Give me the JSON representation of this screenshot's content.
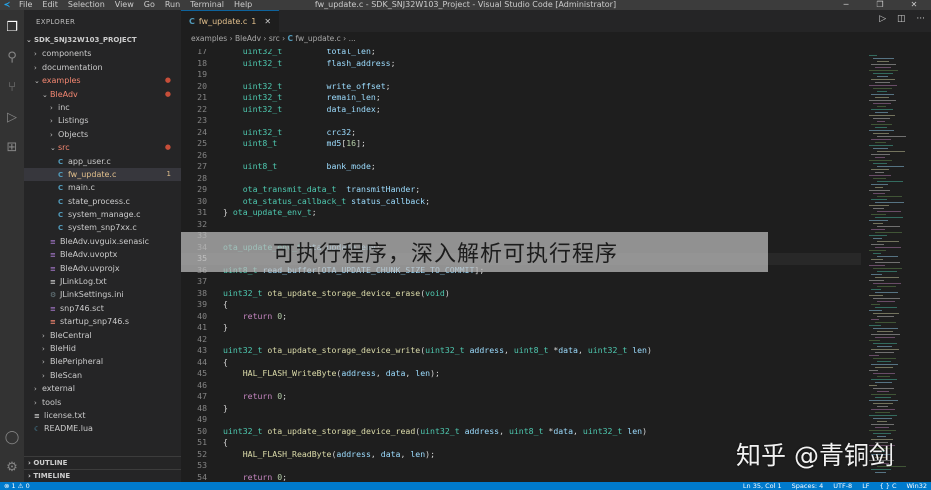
{
  "titlebar": {
    "menu": [
      "File",
      "Edit",
      "Selection",
      "View",
      "Go",
      "Run",
      "Terminal",
      "Help"
    ],
    "title": "fw_update.c - SDK_SNJ32W103_Project - Visual Studio Code [Administrator]"
  },
  "sidebar": {
    "header": "EXPLORER",
    "project": "SDK_SNJ32W103_PROJECT",
    "items": [
      {
        "label": "components",
        "indent": 1,
        "type": "folder",
        "open": false
      },
      {
        "label": "documentation",
        "indent": 1,
        "type": "folder",
        "open": false
      },
      {
        "label": "examples",
        "indent": 1,
        "type": "folder",
        "open": true,
        "color": "red",
        "dot": true
      },
      {
        "label": "BleAdv",
        "indent": 2,
        "type": "folder",
        "open": true,
        "color": "red",
        "dot": true
      },
      {
        "label": "inc",
        "indent": 3,
        "type": "folder",
        "open": false
      },
      {
        "label": "Listings",
        "indent": 3,
        "type": "folder",
        "open": false
      },
      {
        "label": "Objects",
        "indent": 3,
        "type": "folder",
        "open": false
      },
      {
        "label": "src",
        "indent": 3,
        "type": "folder",
        "open": true,
        "color": "red",
        "dot": true
      },
      {
        "label": "app_user.c",
        "indent": 4,
        "type": "c"
      },
      {
        "label": "fw_update.c",
        "indent": 4,
        "type": "c",
        "color": "yellow",
        "selected": true,
        "badge": "1"
      },
      {
        "label": "main.c",
        "indent": 4,
        "type": "c"
      },
      {
        "label": "state_process.c",
        "indent": 4,
        "type": "c"
      },
      {
        "label": "system_manage.c",
        "indent": 4,
        "type": "c"
      },
      {
        "label": "system_snp7xx.c",
        "indent": 4,
        "type": "c"
      },
      {
        "label": "BleAdv.uvguix.senasic",
        "indent": 3,
        "type": "file"
      },
      {
        "label": "BleAdv.uvoptx",
        "indent": 3,
        "type": "file"
      },
      {
        "label": "BleAdv.uvprojx",
        "indent": 3,
        "type": "file"
      },
      {
        "label": "JLinkLog.txt",
        "indent": 3,
        "type": "txt"
      },
      {
        "label": "JLinkSettings.ini",
        "indent": 3,
        "type": "ini"
      },
      {
        "label": "snp746.sct",
        "indent": 3,
        "type": "file"
      },
      {
        "label": "startup_snp746.s",
        "indent": 3,
        "type": "asm"
      },
      {
        "label": "BleCentral",
        "indent": 2,
        "type": "folder",
        "open": false
      },
      {
        "label": "BleHid",
        "indent": 2,
        "type": "folder",
        "open": false
      },
      {
        "label": "BlePeripheral",
        "indent": 2,
        "type": "folder",
        "open": false
      },
      {
        "label": "BleScan",
        "indent": 2,
        "type": "folder",
        "open": false
      },
      {
        "label": "external",
        "indent": 1,
        "type": "folder",
        "open": false
      },
      {
        "label": "tools",
        "indent": 1,
        "type": "folder",
        "open": false
      },
      {
        "label": "license.txt",
        "indent": 1,
        "type": "txt"
      },
      {
        "label": "README.lua",
        "indent": 1,
        "type": "lua"
      }
    ],
    "outline": "OUTLINE",
    "timeline": "TIMELINE"
  },
  "editor": {
    "tab": "fw_update.c",
    "tab_badge": "1",
    "breadcrumb": [
      "examples",
      "BleAdv",
      "src",
      "fw_update.c",
      "..."
    ],
    "lines": [
      {
        "n": "17",
        "tokens": [
          [
            "ty",
            "    uint32_t         "
          ],
          [
            "va",
            "total_len"
          ],
          [
            "pu",
            ";"
          ]
        ]
      },
      {
        "n": "18",
        "tokens": [
          [
            "ty",
            "    uint32_t         "
          ],
          [
            "va",
            "flash_address"
          ],
          [
            "pu",
            ";"
          ]
        ]
      },
      {
        "n": "19",
        "tokens": []
      },
      {
        "n": "20",
        "tokens": [
          [
            "ty",
            "    uint32_t         "
          ],
          [
            "va",
            "write_offset"
          ],
          [
            "pu",
            ";"
          ]
        ]
      },
      {
        "n": "21",
        "tokens": [
          [
            "ty",
            "    uint32_t         "
          ],
          [
            "va",
            "remain_len"
          ],
          [
            "pu",
            ";"
          ]
        ]
      },
      {
        "n": "22",
        "tokens": [
          [
            "ty",
            "    uint32_t         "
          ],
          [
            "va",
            "data_index"
          ],
          [
            "pu",
            ";"
          ]
        ]
      },
      {
        "n": "23",
        "tokens": []
      },
      {
        "n": "24",
        "tokens": [
          [
            "ty",
            "    uint32_t         "
          ],
          [
            "va",
            "crc32"
          ],
          [
            "pu",
            ";"
          ]
        ]
      },
      {
        "n": "25",
        "tokens": [
          [
            "ty",
            "    uint8_t          "
          ],
          [
            "va",
            "md5"
          ],
          [
            "pu",
            "["
          ],
          [
            "nu",
            "16"
          ],
          [
            "pu",
            "];"
          ]
        ]
      },
      {
        "n": "26",
        "tokens": []
      },
      {
        "n": "27",
        "tokens": [
          [
            "ty",
            "    uint8_t          "
          ],
          [
            "va",
            "bank_mode"
          ],
          [
            "pu",
            ";"
          ]
        ]
      },
      {
        "n": "28",
        "tokens": []
      },
      {
        "n": "29",
        "tokens": [
          [
            "ty",
            "    ota_transmit_data_t  "
          ],
          [
            "va",
            "transmitHander"
          ],
          [
            "pu",
            ";"
          ]
        ]
      },
      {
        "n": "30",
        "tokens": [
          [
            "ty",
            "    ota_status_callback_t "
          ],
          [
            "va",
            "status_callback"
          ],
          [
            "pu",
            ";"
          ]
        ]
      },
      {
        "n": "31",
        "tokens": [
          [
            "pu",
            "} "
          ],
          [
            "ty",
            "ota_update_env_t"
          ],
          [
            "pu",
            ";"
          ]
        ]
      },
      {
        "n": "32",
        "tokens": []
      },
      {
        "n": "33",
        "tokens": []
      },
      {
        "n": "34",
        "tokens": [
          [
            "ty",
            "ota_update_env_t "
          ],
          [
            "va",
            "ota_update_env"
          ],
          [
            "pu",
            ";"
          ]
        ]
      },
      {
        "n": "35",
        "tokens": [],
        "current": true
      },
      {
        "n": "36",
        "tokens": [
          [
            "ty",
            "uint8_t "
          ],
          [
            "va",
            "read_buffer"
          ],
          [
            "pu",
            "["
          ],
          [
            "va",
            "OTA_UPDATE_CHUNK_SIZE_TO_COMMIT"
          ],
          [
            "pu",
            "];"
          ]
        ]
      },
      {
        "n": "37",
        "tokens": []
      },
      {
        "n": "38",
        "tokens": [
          [
            "ty",
            "uint32_t "
          ],
          [
            "fn",
            "ota_update_storage_device_erase"
          ],
          [
            "pu",
            "("
          ],
          [
            "ty",
            "void"
          ],
          [
            "pu",
            ")"
          ]
        ]
      },
      {
        "n": "39",
        "tokens": [
          [
            "pu",
            "{"
          ]
        ]
      },
      {
        "n": "40",
        "tokens": [
          [
            "kw",
            "    return "
          ],
          [
            "nu",
            "0"
          ],
          [
            "pu",
            ";"
          ]
        ]
      },
      {
        "n": "41",
        "tokens": [
          [
            "pu",
            "}"
          ]
        ]
      },
      {
        "n": "42",
        "tokens": []
      },
      {
        "n": "43",
        "tokens": [
          [
            "ty",
            "uint32_t "
          ],
          [
            "fn",
            "ota_update_storage_device_write"
          ],
          [
            "pu",
            "("
          ],
          [
            "ty",
            "uint32_t "
          ],
          [
            "va",
            "address"
          ],
          [
            "pu",
            ", "
          ],
          [
            "ty",
            "uint8_t "
          ],
          [
            "pu",
            "*"
          ],
          [
            "va",
            "data"
          ],
          [
            "pu",
            ", "
          ],
          [
            "ty",
            "uint32_t "
          ],
          [
            "va",
            "len"
          ],
          [
            "pu",
            ")"
          ]
        ]
      },
      {
        "n": "44",
        "tokens": [
          [
            "pu",
            "{"
          ]
        ]
      },
      {
        "n": "45",
        "tokens": [
          [
            "fn",
            "    HAL_FLASH_WriteByte"
          ],
          [
            "pu",
            "("
          ],
          [
            "va",
            "address"
          ],
          [
            "pu",
            ", "
          ],
          [
            "va",
            "data"
          ],
          [
            "pu",
            ", "
          ],
          [
            "va",
            "len"
          ],
          [
            "pu",
            ");"
          ]
        ]
      },
      {
        "n": "46",
        "tokens": []
      },
      {
        "n": "47",
        "tokens": [
          [
            "kw",
            "    return "
          ],
          [
            "nu",
            "0"
          ],
          [
            "pu",
            ";"
          ]
        ]
      },
      {
        "n": "48",
        "tokens": [
          [
            "pu",
            "}"
          ]
        ]
      },
      {
        "n": "49",
        "tokens": []
      },
      {
        "n": "50",
        "tokens": [
          [
            "ty",
            "uint32_t "
          ],
          [
            "fn",
            "ota_update_storage_device_read"
          ],
          [
            "pu",
            "("
          ],
          [
            "ty",
            "uint32_t "
          ],
          [
            "va",
            "address"
          ],
          [
            "pu",
            ", "
          ],
          [
            "ty",
            "uint8_t "
          ],
          [
            "pu",
            "*"
          ],
          [
            "va",
            "data"
          ],
          [
            "pu",
            ", "
          ],
          [
            "ty",
            "uint32_t "
          ],
          [
            "va",
            "len"
          ],
          [
            "pu",
            ")"
          ]
        ]
      },
      {
        "n": "51",
        "tokens": [
          [
            "pu",
            "{"
          ]
        ]
      },
      {
        "n": "52",
        "tokens": [
          [
            "fn",
            "    HAL_FLASH_ReadByte"
          ],
          [
            "pu",
            "("
          ],
          [
            "va",
            "address"
          ],
          [
            "pu",
            ", "
          ],
          [
            "va",
            "data"
          ],
          [
            "pu",
            ", "
          ],
          [
            "va",
            "len"
          ],
          [
            "pu",
            ");"
          ]
        ]
      },
      {
        "n": "53",
        "tokens": []
      },
      {
        "n": "54",
        "tokens": [
          [
            "kw",
            "    return "
          ],
          [
            "nu",
            "0"
          ],
          [
            "pu",
            ";"
          ]
        ]
      }
    ]
  },
  "overlay": {
    "banner": "可执行程序，深入解析可执行程序",
    "watermark": "知乎 @青铜剑"
  },
  "statusbar": {
    "left": "⊗ 1 ⚠ 0",
    "right": [
      "Ln 35, Col 1",
      "Spaces: 4",
      "UTF-8",
      "LF",
      "{ } C",
      "Win32"
    ]
  },
  "colors": {
    "accent": "#007acc",
    "activity_bar": "#333333",
    "sidebar": "#252526",
    "editor": "#1e1e1e",
    "modified": "#e2c08d",
    "error": "#f48771"
  }
}
